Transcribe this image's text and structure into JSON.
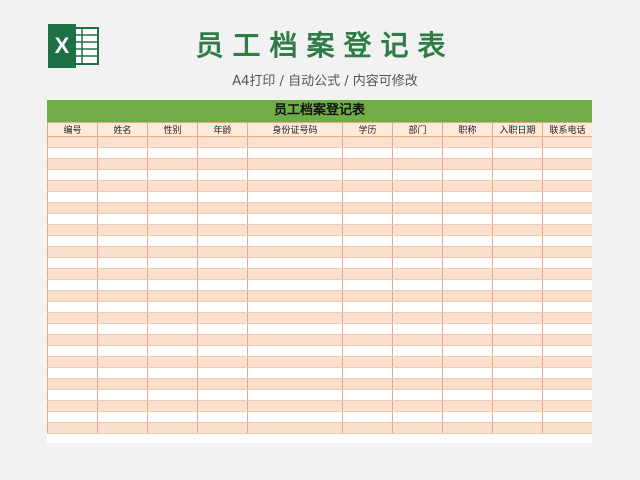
{
  "page": {
    "title": "员工档案登记表",
    "subtitle": "A4打印 / 自动公式 / 内容可修改",
    "logo_icon": "excel-icon",
    "logo_letter": "X",
    "accent_color": "#2e7d46"
  },
  "sheet": {
    "title": "员工档案登记表",
    "header_color": "#70ad47",
    "row_fill_color": "#fbe0cd",
    "columns": [
      "编号",
      "姓名",
      "性别",
      "年龄",
      "身份证号码",
      "学历",
      "部门",
      "职称",
      "入职日期",
      "联系电话"
    ],
    "blank_row_count": 27
  }
}
